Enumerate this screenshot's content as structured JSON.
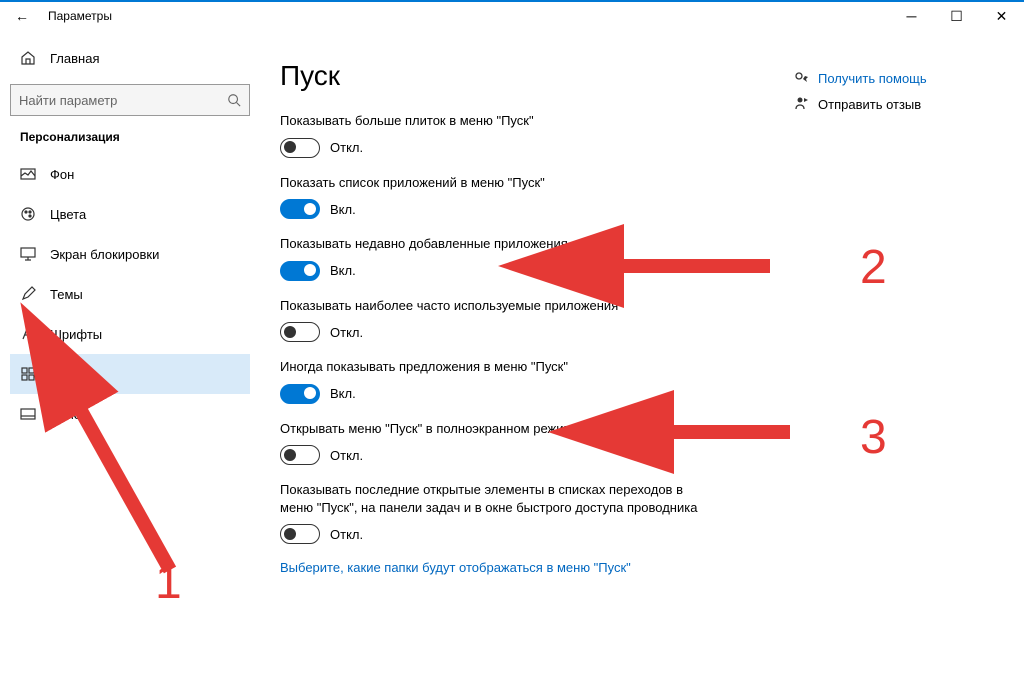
{
  "window": {
    "title": "Параметры"
  },
  "sidebar": {
    "home": "Главная",
    "search_placeholder": "Найти параметр",
    "section": "Персонализация",
    "items": [
      {
        "label": "Фон"
      },
      {
        "label": "Цвета"
      },
      {
        "label": "Экран блокировки"
      },
      {
        "label": "Темы"
      },
      {
        "label": "Шрифты"
      },
      {
        "label": "Пуск"
      },
      {
        "label": "Панел"
      }
    ]
  },
  "page": {
    "title": "Пуск",
    "settings": [
      {
        "label": "Показывать больше плиток в меню \"Пуск\"",
        "on": false,
        "state": "Откл."
      },
      {
        "label": "Показать список приложений в меню \"Пуск\"",
        "on": true,
        "state": "Вкл."
      },
      {
        "label": "Показывать недавно добавленные приложения",
        "on": true,
        "state": "Вкл."
      },
      {
        "label": "Показывать наиболее часто используемые приложения",
        "on": false,
        "state": "Откл."
      },
      {
        "label": "Иногда показывать предложения в меню \"Пуск\"",
        "on": true,
        "state": "Вкл."
      },
      {
        "label": "Открывать меню \"Пуск\" в полноэкранном режиме",
        "on": false,
        "state": "Откл."
      },
      {
        "label": "Показывать последние открытые элементы в списках переходов в меню \"Пуск\", на панели задач и в окне быстрого доступа проводника",
        "on": false,
        "state": "Откл."
      }
    ],
    "folders_link": "Выберите, какие папки будут отображаться в меню \"Пуск\""
  },
  "side": {
    "help": "Получить помощь",
    "feedback": "Отправить отзыв"
  },
  "annotations": {
    "a1": "1",
    "a2": "2",
    "a3": "3"
  }
}
